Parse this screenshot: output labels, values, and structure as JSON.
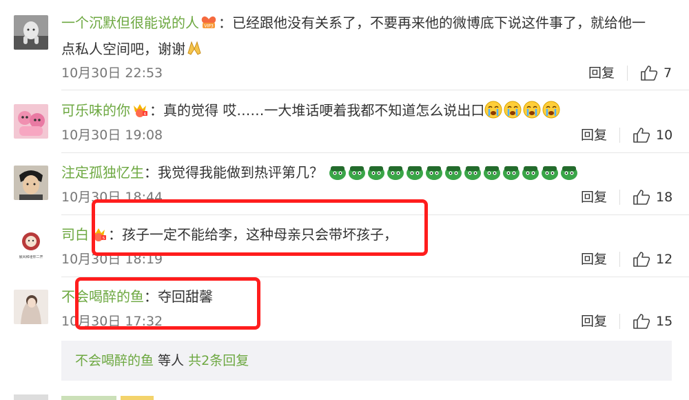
{
  "comments": [
    {
      "username": "一个沉默但很能说的人",
      "text_line1": "已经跟他没有关系了，不要再来他的微博底下说这件事了，就给他一",
      "text_line2": "点私人空间吧，谢谢",
      "time": "10月30日 22:53",
      "reply": "回复",
      "likes": "7"
    },
    {
      "username": "可乐味的你",
      "text_line1": "真的觉得 哎……一大堆话哽着我都不知道怎么说出口",
      "time": "10月30日 19:08",
      "reply": "回复",
      "likes": "10"
    },
    {
      "username": "注定孤独忆生",
      "text_line1": "我觉得我能做到热评第几？",
      "time": "10月30日 18:44",
      "reply": "回复",
      "likes": "18"
    },
    {
      "username": "司白",
      "text_line1": "孩子一定不能给李，这种母亲只会带坏孩子，",
      "time": "10月30日 18:19",
      "reply": "回复",
      "likes": "12"
    },
    {
      "username": "不会喝醉的鱼",
      "text_line1": "夺回甜馨",
      "time": "10月30日 17:32",
      "reply": "回复",
      "likes": "15"
    }
  ],
  "replies_box": {
    "user": "不会喝醉的鱼",
    "mid": " 等人 ",
    "count": "共2条回复"
  },
  "colors": {
    "username": "#6da841",
    "highlight": "#ff1d1d",
    "reply_bg": "#f2f2f5"
  },
  "avatar_caption": "晨风和瑾你二开"
}
